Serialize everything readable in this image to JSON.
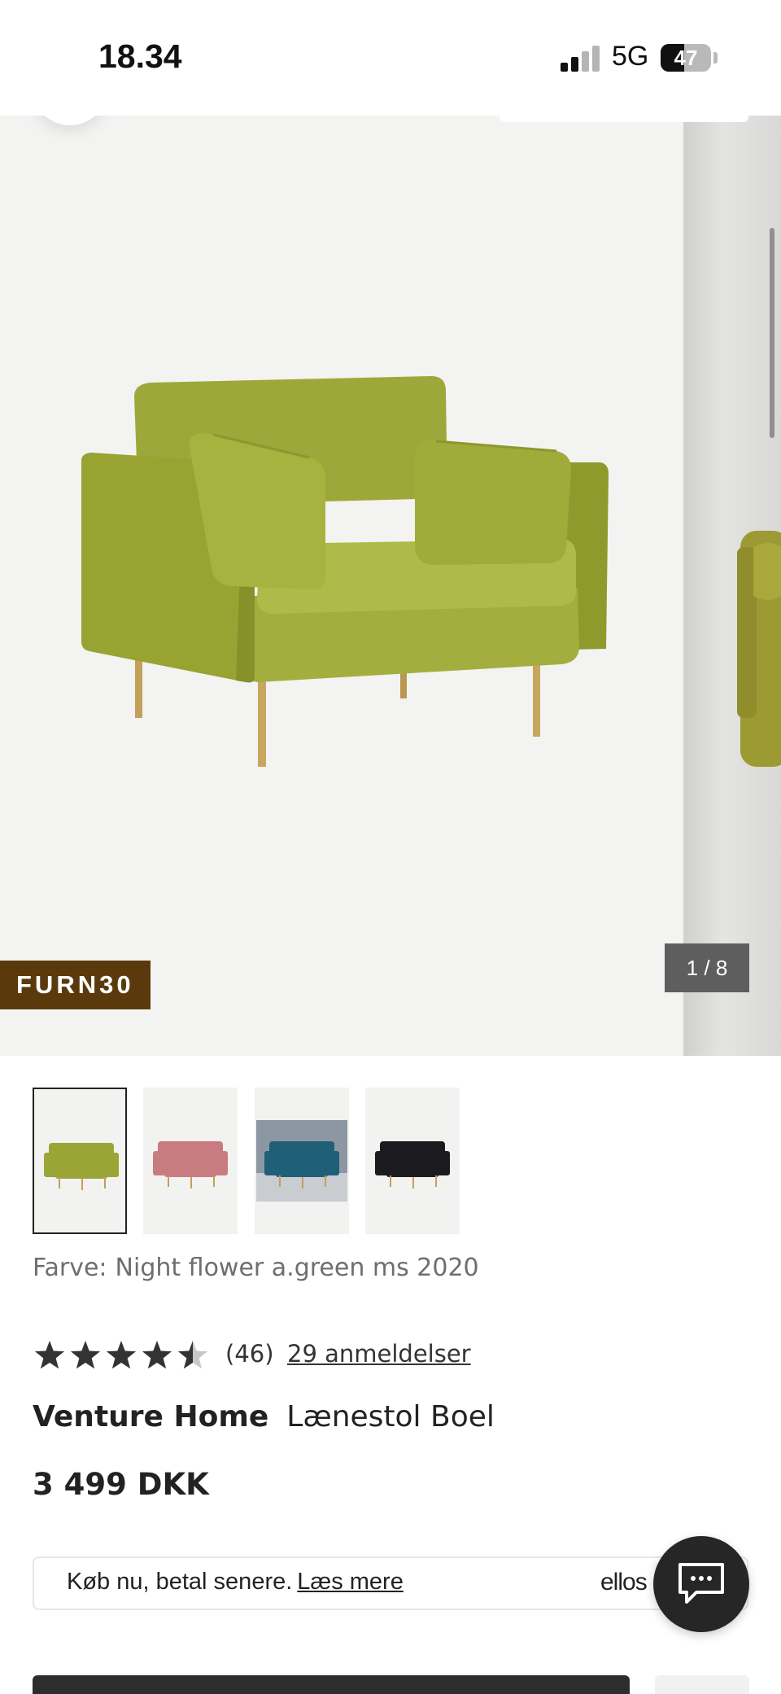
{
  "status_bar": {
    "time": "18.34",
    "network": "5G",
    "battery": "47",
    "battery_level": 0.47
  },
  "gallery": {
    "promo_code": "FURN30",
    "slide_counter": "1 / 8"
  },
  "swatches": [
    {
      "name": "green",
      "color": "#9aa536",
      "selected": true
    },
    {
      "name": "pink",
      "color": "#c97c7f",
      "selected": false
    },
    {
      "name": "blue",
      "color": "#1f5f78",
      "selected": false
    },
    {
      "name": "black",
      "color": "#1b1b1f",
      "selected": false
    }
  ],
  "color_label": {
    "label": "Farve:",
    "value": "Night flower a.green ms 2020"
  },
  "rating": {
    "stars": 4.5,
    "count": "(46)",
    "reviews_link": "29 anmeldelser"
  },
  "product": {
    "brand": "Venture Home",
    "name": "Lænestol Boel",
    "price": "3 499 DKK"
  },
  "financing": {
    "text": "Køb nu, betal senere.",
    "link": "Læs mere",
    "provider": "ellos"
  },
  "icons": {
    "back": "chevron-left-icon",
    "chat": "chat-bubble-icon",
    "star": "star-icon"
  },
  "colors": {
    "promo_badge": "#5a3a0c",
    "chat_button": "#262626",
    "star": "#333333"
  }
}
